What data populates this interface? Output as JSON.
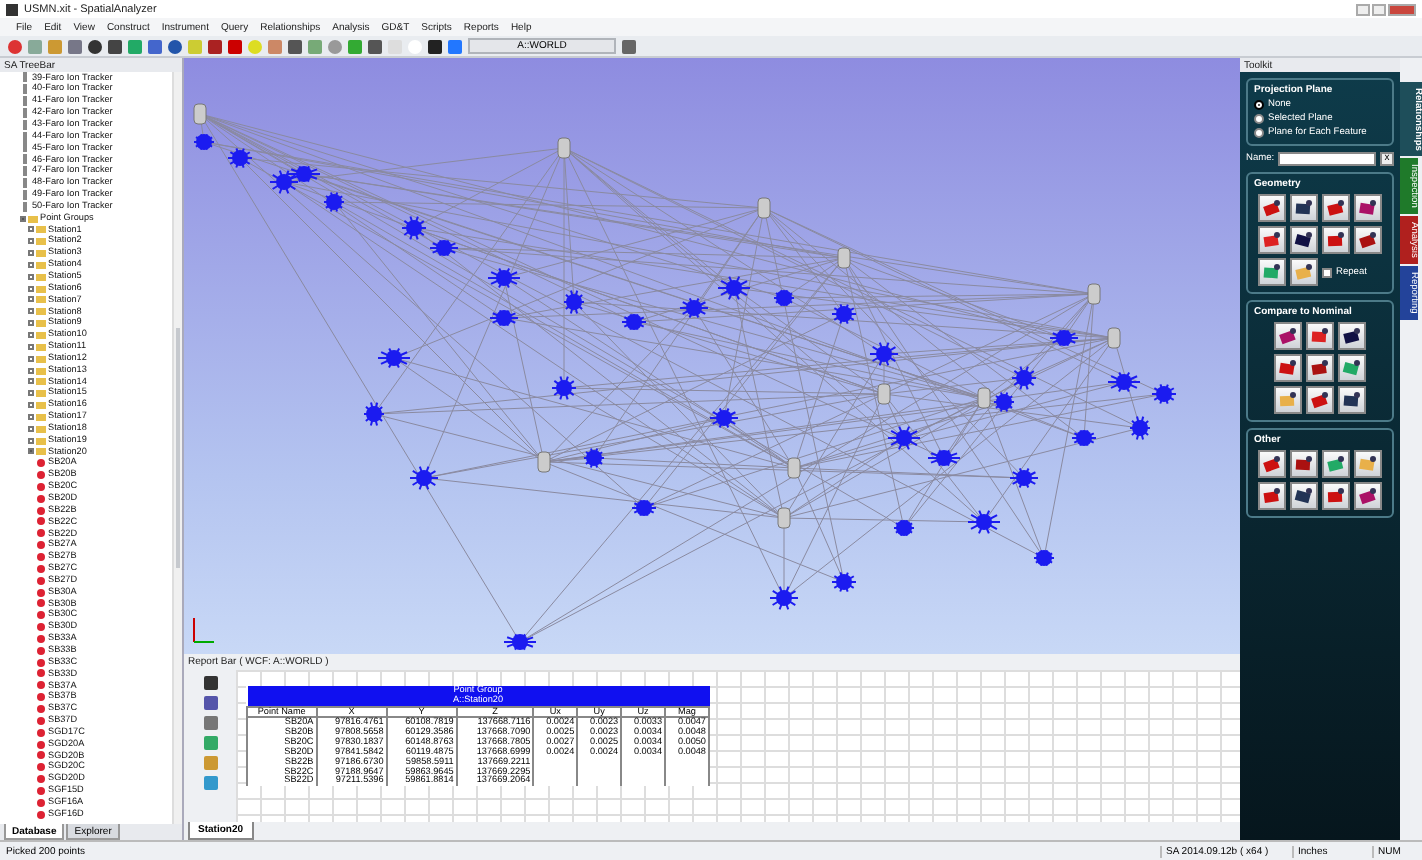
{
  "window": {
    "title": "USMN.xit - SpatialAnalyzer"
  },
  "menu": [
    "File",
    "Edit",
    "View",
    "Construct",
    "Instrument",
    "Query",
    "Relationships",
    "Analysis",
    "GD&T",
    "Scripts",
    "Reports",
    "Help"
  ],
  "toolbar": {
    "frame_field": "A::WORLD"
  },
  "tree": {
    "title": "SA TreeBar",
    "items": [
      {
        "kind": "instrument",
        "label": "39-Faro Ion Tracker"
      },
      {
        "kind": "instrument",
        "label": "40-Faro Ion Tracker"
      },
      {
        "kind": "instrument",
        "label": "41-Faro Ion Tracker"
      },
      {
        "kind": "instrument",
        "label": "42-Faro Ion Tracker"
      },
      {
        "kind": "instrument",
        "label": "43-Faro Ion Tracker"
      },
      {
        "kind": "instrument",
        "label": "44-Faro Ion Tracker"
      },
      {
        "kind": "instrument",
        "label": "45-Faro Ion Tracker"
      },
      {
        "kind": "instrument",
        "label": "46-Faro Ion Tracker"
      },
      {
        "kind": "instrument",
        "label": "47-Faro Ion Tracker"
      },
      {
        "kind": "instrument",
        "label": "48-Faro Ion Tracker"
      },
      {
        "kind": "instrument",
        "label": "49-Faro Ion Tracker"
      },
      {
        "kind": "instrument",
        "label": "50-Faro Ion Tracker"
      },
      {
        "kind": "folder",
        "label": "Point Groups",
        "expanded": true,
        "children": [
          {
            "kind": "group",
            "label": "Station1",
            "expanded": false
          },
          {
            "kind": "group",
            "label": "Station2",
            "expanded": false
          },
          {
            "kind": "group",
            "label": "Station3",
            "expanded": false
          },
          {
            "kind": "group",
            "label": "Station4",
            "expanded": false
          },
          {
            "kind": "group",
            "label": "Station5",
            "expanded": false
          },
          {
            "kind": "group",
            "label": "Station6",
            "expanded": false
          },
          {
            "kind": "group",
            "label": "Station7",
            "expanded": false
          },
          {
            "kind": "group",
            "label": "Station8",
            "expanded": false
          },
          {
            "kind": "group",
            "label": "Station9",
            "expanded": false
          },
          {
            "kind": "group",
            "label": "Station10",
            "expanded": false
          },
          {
            "kind": "group",
            "label": "Station11",
            "expanded": false
          },
          {
            "kind": "group",
            "label": "Station12",
            "expanded": false
          },
          {
            "kind": "group",
            "label": "Station13",
            "expanded": false
          },
          {
            "kind": "group",
            "label": "Station14",
            "expanded": false
          },
          {
            "kind": "group",
            "label": "Station15",
            "expanded": false
          },
          {
            "kind": "group",
            "label": "Station16",
            "expanded": false
          },
          {
            "kind": "group",
            "label": "Station17",
            "expanded": false
          },
          {
            "kind": "group",
            "label": "Station18",
            "expanded": false
          },
          {
            "kind": "group",
            "label": "Station19",
            "expanded": false
          },
          {
            "kind": "group",
            "label": "Station20",
            "expanded": true,
            "children": [
              {
                "kind": "point",
                "label": "SB20A"
              },
              {
                "kind": "point",
                "label": "SB20B"
              },
              {
                "kind": "point",
                "label": "SB20C"
              },
              {
                "kind": "point",
                "label": "SB20D"
              },
              {
                "kind": "point",
                "label": "SB22B"
              },
              {
                "kind": "point",
                "label": "SB22C"
              },
              {
                "kind": "point",
                "label": "SB22D"
              },
              {
                "kind": "point",
                "label": "SB27A"
              },
              {
                "kind": "point",
                "label": "SB27B"
              },
              {
                "kind": "point",
                "label": "SB27C"
              },
              {
                "kind": "point",
                "label": "SB27D"
              },
              {
                "kind": "point",
                "label": "SB30A"
              },
              {
                "kind": "point",
                "label": "SB30B"
              },
              {
                "kind": "point",
                "label": "SB30C"
              },
              {
                "kind": "point",
                "label": "SB30D"
              },
              {
                "kind": "point",
                "label": "SB33A"
              },
              {
                "kind": "point",
                "label": "SB33B"
              },
              {
                "kind": "point",
                "label": "SB33C"
              },
              {
                "kind": "point",
                "label": "SB33D"
              },
              {
                "kind": "point",
                "label": "SB37A"
              },
              {
                "kind": "point",
                "label": "SB37B"
              },
              {
                "kind": "point",
                "label": "SB37C"
              },
              {
                "kind": "point",
                "label": "SB37D"
              },
              {
                "kind": "point",
                "label": "SGD17C"
              },
              {
                "kind": "point",
                "label": "SGD20A"
              },
              {
                "kind": "point",
                "label": "SGD20B"
              },
              {
                "kind": "point",
                "label": "SGD20C"
              },
              {
                "kind": "point",
                "label": "SGD20D"
              },
              {
                "kind": "point",
                "label": "SGF15D"
              },
              {
                "kind": "point",
                "label": "SGF16A"
              },
              {
                "kind": "point",
                "label": "SGF16D"
              }
            ]
          }
        ]
      }
    ],
    "bottom_tabs": [
      {
        "label": "Database",
        "selected": true
      },
      {
        "label": "Explorer",
        "selected": false
      }
    ]
  },
  "report_bar": {
    "title": "Report Bar ( WCF: A::WORLD )",
    "table": {
      "title": "Point Group",
      "subtitle": "A::Station20",
      "columns": [
        "Point Name",
        "X",
        "Y",
        "Z",
        "Ux",
        "Uy",
        "Uz",
        "Mag"
      ],
      "rows": [
        [
          "SB20A",
          "97816.4761",
          "60108.7819",
          "137668.7116",
          "0.0024",
          "0.0023",
          "0.0033",
          "0.0047"
        ],
        [
          "SB20B",
          "97808.5658",
          "60129.3586",
          "137668.7090",
          "0.0025",
          "0.0023",
          "0.0034",
          "0.0048"
        ],
        [
          "SB20C",
          "97830.1837",
          "60148.8763",
          "137668.7805",
          "0.0027",
          "0.0025",
          "0.0034",
          "0.0050"
        ],
        [
          "SB20D",
          "97841.5842",
          "60119.4875",
          "137668.6999",
          "0.0024",
          "0.0024",
          "0.0034",
          "0.0048"
        ],
        [
          "SB22B",
          "97186.6730",
          "59858.5911",
          "137669.2211",
          "",
          "",
          "",
          ""
        ],
        [
          "SB22C",
          "97188.9647",
          "59863.9645",
          "137669.2295",
          "",
          "",
          "",
          ""
        ],
        [
          "SB22D",
          "97211.5396",
          "59861.8814",
          "137669.2064",
          "",
          "",
          "",
          ""
        ]
      ]
    },
    "tabs": [
      {
        "label": "Station20",
        "selected": true
      }
    ]
  },
  "toolkit": {
    "title": "Toolkit",
    "projection_plane": {
      "title": "Projection Plane",
      "options": [
        {
          "label": "None",
          "selected": true
        },
        {
          "label": "Selected Plane",
          "selected": false
        },
        {
          "label": "Plane for Each Feature",
          "selected": false
        }
      ]
    },
    "name_field": {
      "label": "Name:",
      "clear_button": "x"
    },
    "geometry": {
      "title": "Geometry",
      "repeat": {
        "label": "Repeat",
        "checked": false
      }
    },
    "compare": {
      "title": "Compare to Nominal"
    },
    "other": {
      "title": "Other"
    },
    "side_tabs": [
      {
        "label": "Relationships",
        "selected": true,
        "color": "#1e4e5a"
      },
      {
        "label": "Inspection",
        "selected": false,
        "color": "#1f7a2a"
      },
      {
        "label": "Analysis",
        "selected": false,
        "color": "#b0201e"
      },
      {
        "label": "Reporting",
        "selected": false,
        "color": "#23439a"
      }
    ]
  },
  "status_bar": {
    "message": "Picked 200 points",
    "version": "SA 2014.09.12b ( x64 )",
    "units": "Inches",
    "keys": "NUM"
  }
}
